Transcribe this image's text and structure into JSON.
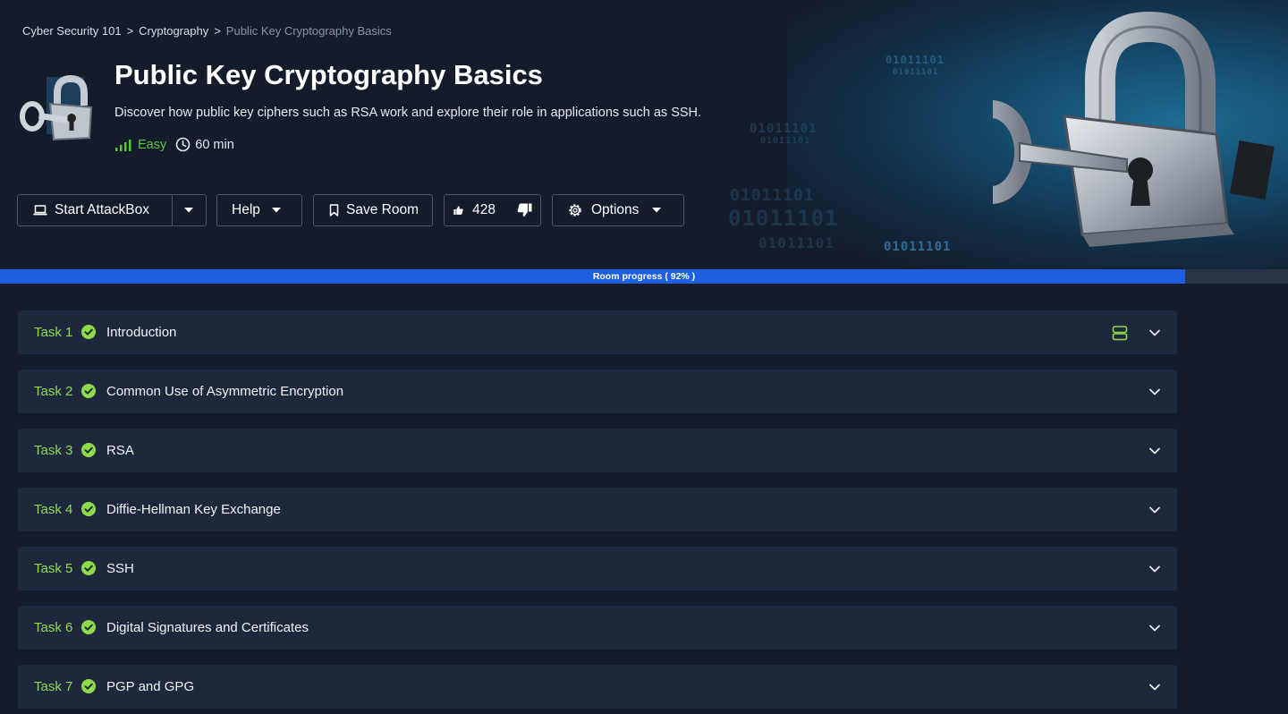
{
  "breadcrumb": {
    "items": [
      "Cyber Security 101",
      "Cryptography"
    ],
    "current": "Public Key Cryptography Basics",
    "separator": ">"
  },
  "room": {
    "title": "Public Key Cryptography Basics",
    "description": "Discover how public key ciphers such as RSA work and explore their role in applications such as SSH.",
    "difficulty": "Easy",
    "duration": "60 min"
  },
  "toolbar": {
    "start_attackbox": "Start AttackBox",
    "help": "Help",
    "save_room": "Save Room",
    "likes": "428",
    "options": "Options"
  },
  "hero_binary": [
    "01011101",
    "01011101",
    "01011101",
    "01011101",
    "01011101",
    "01011101",
    "01011101",
    "01011101"
  ],
  "progress": {
    "label": "Room progress ( 92% )",
    "percent": 92
  },
  "tasks": [
    {
      "label": "Task 1",
      "title": "Introduction"
    },
    {
      "label": "Task 2",
      "title": "Common Use of Asymmetric Encryption"
    },
    {
      "label": "Task 3",
      "title": "RSA"
    },
    {
      "label": "Task 4",
      "title": "Diffie-Hellman Key Exchange"
    },
    {
      "label": "Task 5",
      "title": "SSH"
    },
    {
      "label": "Task 6",
      "title": "Digital Signatures and Certificates"
    },
    {
      "label": "Task 7",
      "title": "PGP and GPG"
    }
  ],
  "colors": {
    "accent_green": "#8fdc4a",
    "easy_green": "#59c43f",
    "progress_blue": "#1e5fe0",
    "task_bg": "#1e283c",
    "page_bg": "#141c2b"
  }
}
